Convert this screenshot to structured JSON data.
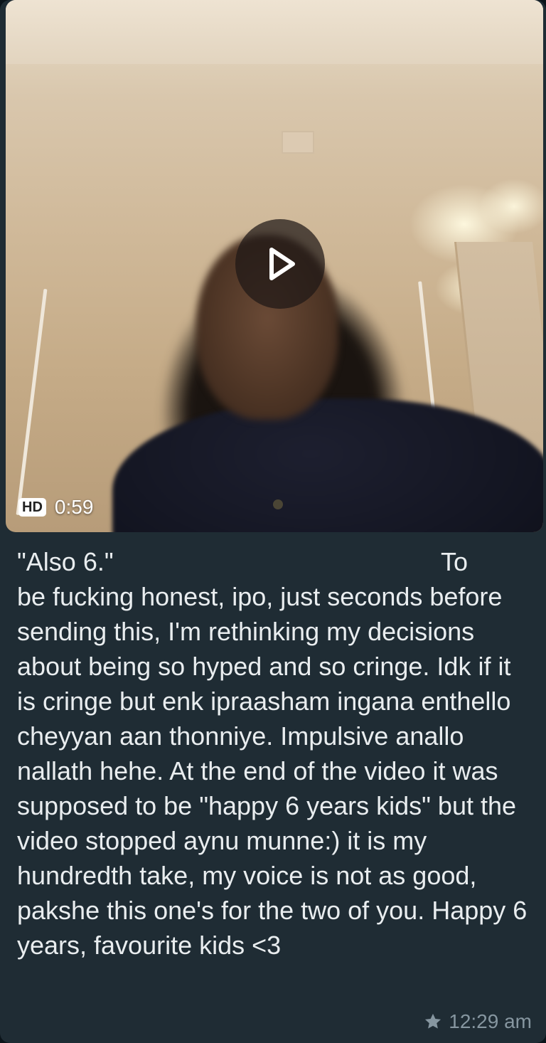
{
  "video": {
    "badge": "HD",
    "duration": "0:59",
    "play_icon": "play-icon"
  },
  "caption": {
    "first_left": "\"Also 6.\"",
    "first_right": "To",
    "body": "be fucking honest, ipo, just seconds before sending this, I'm rethinking my decisions about being so hyped and so cringe. Idk if it is cringe but enk ipraasham ingana enthello cheyyan aan thonniye. Impulsive anallo nallath hehe. At the end of the video it was supposed to be \"happy 6 years kids\" but the video stopped aynu munne:) it is my hundredth take, my voice is not as good, pakshe this one's for the two of you. Happy 6 years, favourite kids <3"
  },
  "meta": {
    "star_icon": "star-icon",
    "time": "12:29 am"
  },
  "colors": {
    "bubble": "#1f2c34",
    "text": "#e9edef",
    "meta": "#8696a0"
  }
}
